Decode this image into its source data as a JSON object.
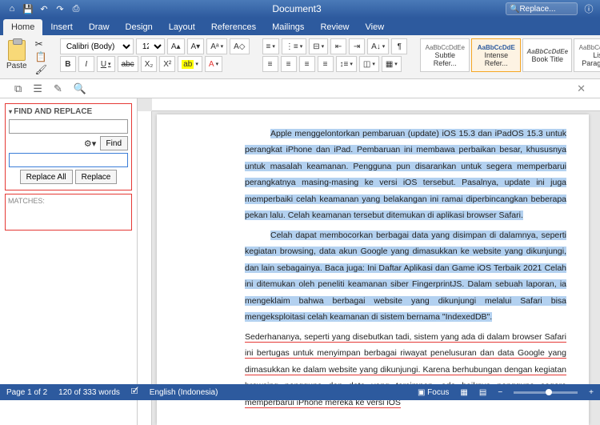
{
  "title": "Document3",
  "search_placeholder": "Replace...",
  "tabs": [
    "Home",
    "Insert",
    "Draw",
    "Design",
    "Layout",
    "References",
    "Mailings",
    "Review",
    "View"
  ],
  "clipboard": {
    "paste": "Paste"
  },
  "font": {
    "name": "Calibri (Body)",
    "size": "12",
    "bold": "B",
    "italic": "I",
    "underline": "U",
    "strike": "abc",
    "sub": "X₂",
    "sup": "X²"
  },
  "styles": [
    {
      "sample": "AaBbCcDdEe",
      "name": "Subtle Refer..."
    },
    {
      "sample": "AaBbCcDdE",
      "name": "Intense Refer..."
    },
    {
      "sample": "AaBbCcDdEe",
      "name": "Book Title"
    },
    {
      "sample": "AaBbCcDdEe",
      "name": "List Paragraph"
    }
  ],
  "find_replace": {
    "title": "FIND AND REPLACE",
    "find_btn": "Find",
    "replace_all": "Replace All",
    "replace": "Replace",
    "matches_label": "MATCHES:"
  },
  "paragraphs": {
    "p1": "Apple menggelontorkan pembaruan (update) iOS 15.3 dan iPadOS 15.3 untuk perangkat iPhone dan iPad. Pembaruan ini membawa perbaikan besar, khususnya untuk masalah keamanan. Pengguna pun disarankan untuk segera memperbarui perangkatnya masing-masing ke versi iOS tersebut. Pasalnya, update ini juga memperbaiki celah keamanan yang belakangan ini ramai diperbincangkan beberapa pekan lalu. Celah keamanan tersebut ditemukan di aplikasi browser Safari.",
    "p2": "Celah dapat membocorkan berbagai data yang disimpan di dalamnya, seperti kegiatan browsing, data akun Google yang dimasukkan ke website yang dikunjungi, dan lain sebagainya. Baca juga: Ini Daftar Aplikasi dan Game iOS Terbaik 2021 Celah ini ditemukan oleh peneliti keamanan siber FingerprintJS. Dalam sebuah laporan, ia mengeklaim bahwa berbagai website yang dikunjungi melalui Safari bisa mengeksploitasi celah keamanan di sistem bernama \"IndexedDB\".",
    "p3": "Sederhananya, seperti yang disebutkan tadi, sistem yang ada di dalam browser Safari ini bertugas untuk menyimpan berbagai riwayat penelusuran dan data Google yang dimasukkan ke dalam website yang dikunjungi. Karena berhubungan dengan kegiatan browsing pengguna dan data yang tersimpan, ada baiknya pengguna segera memperbarui iPhone mereka ke versi iOS"
  },
  "status": {
    "page": "Page 1 of 2",
    "words": "120 of 333 words",
    "lang": "English (Indonesia)",
    "focus": "Focus"
  }
}
